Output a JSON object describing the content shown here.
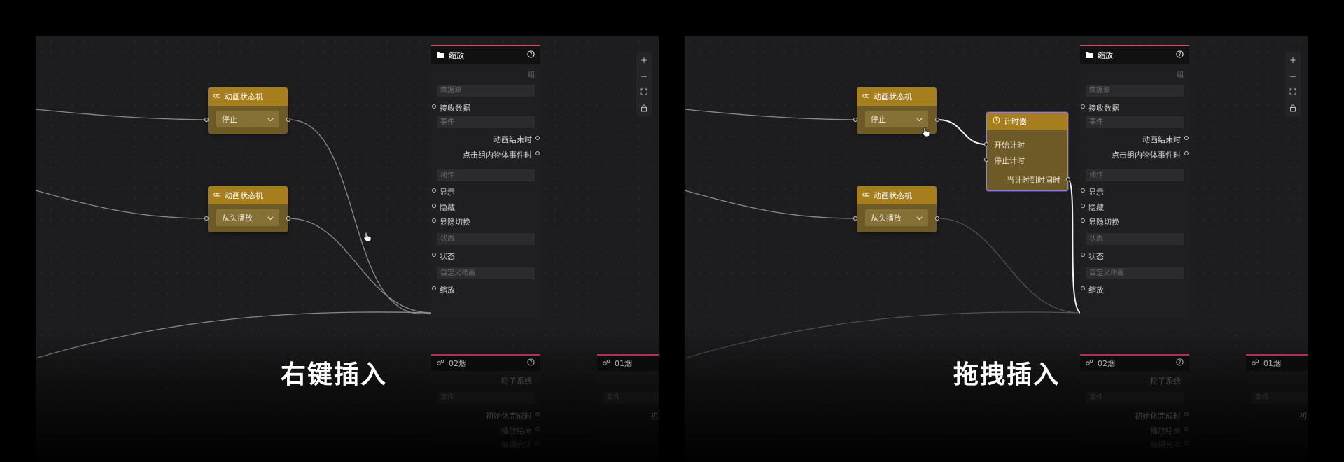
{
  "left_panel": {
    "caption": "右键插入",
    "nodes": [
      {
        "title": "动画状态机",
        "value": "停止"
      },
      {
        "title": "动画状态机",
        "value": "从头播放"
      }
    ]
  },
  "right_panel": {
    "caption": "拖拽插入",
    "nodes": [
      {
        "title": "动画状态机",
        "value": "停止"
      },
      {
        "title": "动画状态机",
        "value": "从头播放"
      }
    ],
    "timer_node": {
      "title": "计时器",
      "inputs": [
        "开始计时",
        "停止计时"
      ],
      "outputs": [
        "当计时到时间时"
      ]
    }
  },
  "inspector": {
    "title": "缩放",
    "group_label": "组",
    "data_source_section": "数据源",
    "receive_data": "接收数据",
    "event_section": "事件",
    "events": [
      "动画结束时",
      "点击组内物体事件时"
    ],
    "action_section": "动作",
    "actions": [
      "显示",
      "隐藏",
      "显隐切换"
    ],
    "state_section": "状态",
    "state_item": "状态",
    "custom_anim_section": "自定义动画",
    "scale_item": "缩放"
  },
  "lower_panels": {
    "smoke02": {
      "title": "02烟",
      "subtitle": "粒子系统",
      "event_section": "事件",
      "events": [
        "初始化完成时",
        "播放结束",
        "编辑完毕"
      ]
    },
    "smoke01": {
      "title": "01烟",
      "event_section": "事件",
      "event_partial": "初"
    }
  },
  "zoom_controls": {
    "zoom_in": "+",
    "zoom_out": "−"
  },
  "colors": {
    "node_header": "#a67e1e",
    "node_body": "#6e5a26",
    "panel_accent": "#e0456a",
    "timer_outline": "#8e7cf0",
    "canvas": "#1d1d1f"
  },
  "icons": [
    "folder-icon",
    "help-icon",
    "state-machine-icon",
    "chevron-down-icon",
    "clock-icon",
    "particle-icon",
    "zoom-in-icon",
    "zoom-out-icon",
    "fit-view-icon",
    "lock-icon",
    "hand-cursor-icon"
  ]
}
